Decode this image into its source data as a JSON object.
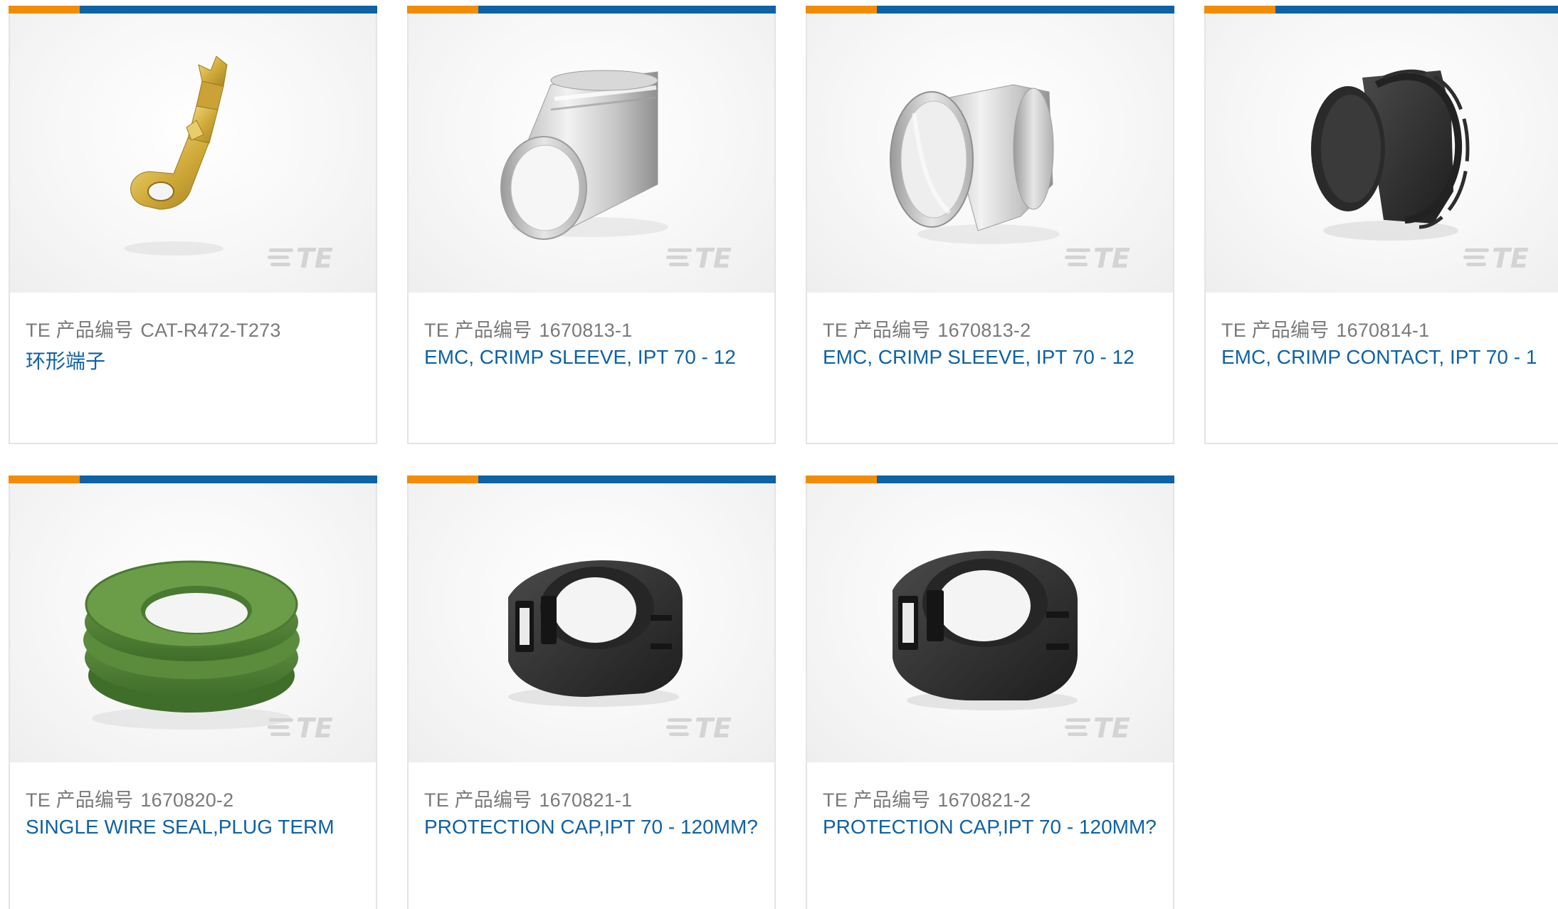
{
  "colors": {
    "accent_orange": "#f28c00",
    "accent_blue": "#0e62a5",
    "card_border": "#e4e4e4",
    "meta_text": "#7a7a7a",
    "link_text": "#0e62a5"
  },
  "products": [
    {
      "prefix": "TE 产品编号",
      "part_number": "CAT-R472-T273",
      "title": "环形端子",
      "image_icon": "ring-terminal-icon",
      "watermark": "TE"
    },
    {
      "prefix": "TE 产品编号",
      "part_number": "1670813-1",
      "title": "EMC, CRIMP SLEEVE, IPT 70 - 12",
      "image_icon": "crimp-sleeve-icon",
      "watermark": "TE"
    },
    {
      "prefix": "TE 产品编号",
      "part_number": "1670813-2",
      "title": "EMC, CRIMP SLEEVE, IPT 70 - 12",
      "image_icon": "crimp-sleeve-icon",
      "watermark": "TE"
    },
    {
      "prefix": "TE 产品编号",
      "part_number": "1670814-1",
      "title": "EMC, CRIMP CONTACT, IPT 70 - 1",
      "image_icon": "crimp-contact-icon",
      "watermark": "TE"
    },
    {
      "prefix": "TE 产品编号",
      "part_number": "1670820-2",
      "title": "SINGLE WIRE SEAL,PLUG TERM",
      "image_icon": "wire-seal-icon",
      "watermark": "TE"
    },
    {
      "prefix": "TE 产品编号",
      "part_number": "1670821-1",
      "title": "PROTECTION CAP,IPT 70 - 120MM?",
      "image_icon": "protection-cap-icon",
      "watermark": "TE"
    },
    {
      "prefix": "TE 产品编号",
      "part_number": "1670821-2",
      "title": "PROTECTION CAP,IPT 70 - 120MM?",
      "image_icon": "protection-cap-icon",
      "watermark": "TE"
    }
  ]
}
